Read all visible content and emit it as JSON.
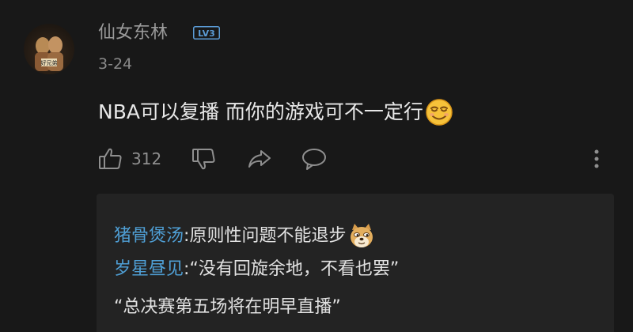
{
  "comment": {
    "username": "仙女东林",
    "level_badge": "LV3",
    "avatar_text": "好兄弟",
    "date": "3-24",
    "content": "NBA可以复播 而你的游戏可不一定行",
    "content_emoji": "smirk-face-icon",
    "like_count": "312"
  },
  "replies": [
    {
      "author": "猪骨煲汤",
      "separator": ": ",
      "text": "原则性问题不能退步",
      "emoji": "doge-icon"
    },
    {
      "author": "岁星昼见",
      "separator": ": ",
      "text": "“没有回旋余地，不看也罢”"
    },
    {
      "text": "“总决赛第五场将在明早直播”"
    }
  ],
  "colors": {
    "background": "#181818",
    "reply_box": "#232323",
    "username": "#9a9a9a",
    "content": "#e8e8e8",
    "reply_author": "#4f9fd5",
    "level_badge": "#5b9bd5"
  }
}
